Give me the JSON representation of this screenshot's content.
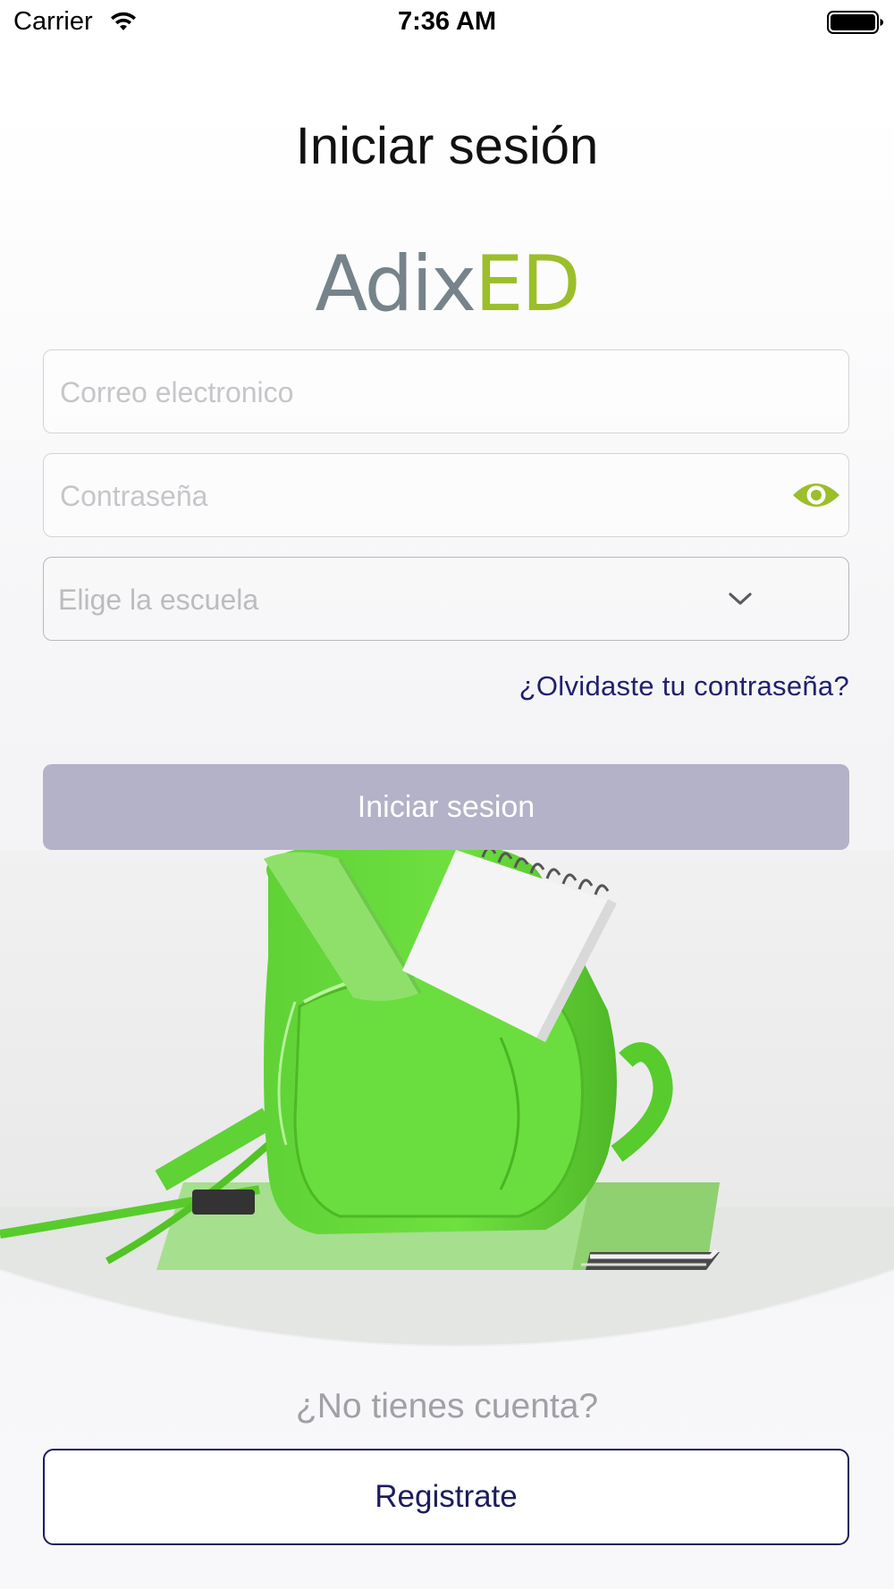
{
  "status_bar": {
    "carrier": "Carrier",
    "time": "7:36 AM"
  },
  "title": "Iniciar sesión",
  "logo": {
    "part1": "Adix",
    "part2": "ED",
    "color1": "#76838a",
    "color2": "#9bbf2a"
  },
  "form": {
    "email_placeholder": "Correo electronico",
    "password_placeholder": "Contraseña",
    "school_placeholder": "Elige la escuela",
    "forgot_password": "¿Olvidaste tu contraseña?",
    "submit_label": "Iniciar sesion"
  },
  "footer": {
    "prompt": "¿No tienes cuenta?",
    "register_label": "Registrate"
  },
  "colors": {
    "accent_green": "#9bbf2a",
    "navy": "#1c1c5c",
    "button_disabled": "#b4b2c8"
  },
  "icons": {
    "wifi": "wifi-icon",
    "battery": "battery-icon",
    "password_toggle": "eye-icon",
    "select": "chevron-down-icon"
  }
}
